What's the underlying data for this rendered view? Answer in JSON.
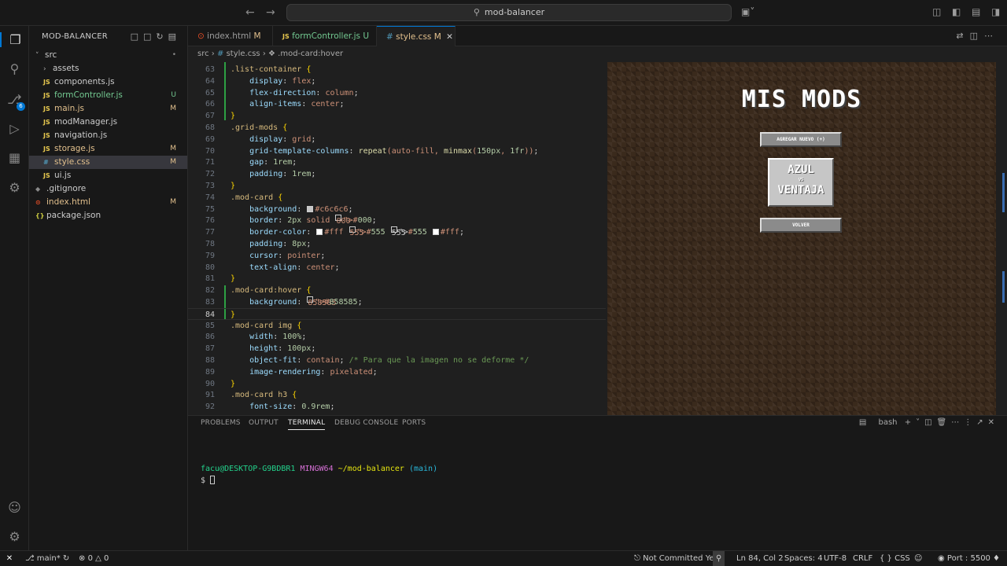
{
  "titlebar": {
    "back_icon": "arrow-left",
    "forward_icon": "arrow-right",
    "search_text": "mod-balancer"
  },
  "activity": {
    "scm_badge": "6"
  },
  "sidebar": {
    "header": "MOD-BALANCER",
    "items": [
      {
        "label": "src",
        "kind": "folder-open",
        "depth": 0,
        "status": "•"
      },
      {
        "label": "assets",
        "kind": "folder",
        "depth": 1,
        "status": ""
      },
      {
        "label": "components.js",
        "kind": "js",
        "depth": 1,
        "status": ""
      },
      {
        "label": "formController.js",
        "kind": "js",
        "depth": 1,
        "status": "U"
      },
      {
        "label": "main.js",
        "kind": "js",
        "depth": 1,
        "status": "M"
      },
      {
        "label": "modManager.js",
        "kind": "js",
        "depth": 1,
        "status": ""
      },
      {
        "label": "navigation.js",
        "kind": "js",
        "depth": 1,
        "status": ""
      },
      {
        "label": "storage.js",
        "kind": "js",
        "depth": 1,
        "status": "M"
      },
      {
        "label": "style.css",
        "kind": "css",
        "depth": 1,
        "status": "M"
      },
      {
        "label": "ui.js",
        "kind": "js",
        "depth": 1,
        "status": ""
      },
      {
        "label": ".gitignore",
        "kind": "git",
        "depth": 0,
        "status": ""
      },
      {
        "label": "index.html",
        "kind": "html",
        "depth": 0,
        "status": "M"
      },
      {
        "label": "package.json",
        "kind": "json",
        "depth": 0,
        "status": ""
      }
    ]
  },
  "tabs": [
    {
      "label": "index.html",
      "status": "M",
      "kind": "html"
    },
    {
      "label": "formController.js",
      "status": "U",
      "kind": "js"
    },
    {
      "label": "style.css",
      "status": "M",
      "kind": "css",
      "active": true
    }
  ],
  "breadcrumb": {
    "part1": "src",
    "part2": "style.css",
    "part3": ".mod-card:hover"
  },
  "code_lines": [
    {
      "n": "63",
      "text": ".list-container {"
    },
    {
      "n": "64",
      "text": "    display: flex;"
    },
    {
      "n": "65",
      "text": "    flex-direction: column;"
    },
    {
      "n": "66",
      "text": "    align-items: center;"
    },
    {
      "n": "67",
      "text": "}"
    },
    {
      "n": "68",
      "text": ".grid-mods {"
    },
    {
      "n": "69",
      "text": "    display: grid;"
    },
    {
      "n": "70",
      "text": "    grid-template-columns: repeat(auto-fill, minmax(150px, 1fr));"
    },
    {
      "n": "71",
      "text": "    gap: 1rem;"
    },
    {
      "n": "72",
      "text": "    padding: 1rem;"
    },
    {
      "n": "73",
      "text": "}"
    },
    {
      "n": "74",
      "text": ".mod-card {"
    },
    {
      "n": "75",
      "text": "    background: #c6c6c6;"
    },
    {
      "n": "76",
      "text": "    border: 2px solid #000;"
    },
    {
      "n": "77",
      "text": "    border-color: #fff #555 #555 #fff;"
    },
    {
      "n": "78",
      "text": "    padding: 8px;"
    },
    {
      "n": "79",
      "text": "    cursor: pointer;"
    },
    {
      "n": "80",
      "text": "    text-align: center;"
    },
    {
      "n": "81",
      "text": "}"
    },
    {
      "n": "82",
      "text": ".mod-card:hover {"
    },
    {
      "n": "83",
      "text": "    background: #858585;"
    },
    {
      "n": "84",
      "text": "}"
    },
    {
      "n": "85",
      "text": ".mod-card img {"
    },
    {
      "n": "86",
      "text": "    width: 100%;"
    },
    {
      "n": "87",
      "text": "    height: 100px;"
    },
    {
      "n": "88",
      "text": "    object-fit: contain; /* Para que la imagen no se deforme */"
    },
    {
      "n": "89",
      "text": "    image-rendering: pixelated;"
    },
    {
      "n": "90",
      "text": "}"
    },
    {
      "n": "91",
      "text": ".mod-card h3 {"
    },
    {
      "n": "92",
      "text": "    font-size: 0.9rem;"
    }
  ],
  "preview": {
    "title": "MIS MODS",
    "add_button": "AGREGAR NUEVO (+)",
    "card_line1": "AZUL",
    "card_line2": "VS",
    "card_line3": "VENTAJA",
    "back_button": "VOLVER"
  },
  "panel": {
    "tabs": [
      "PROBLEMS",
      "OUTPUT",
      "TERMINAL",
      "DEBUG CONSOLE",
      "PORTS"
    ],
    "active_tab": "TERMINAL",
    "shell": "bash",
    "prompt_user": "facu@DESKTOP-G9BDBR1",
    "prompt_env": "MINGW64",
    "prompt_path": "~/mod-balancer",
    "prompt_branch": "(main)",
    "prompt_symbol": "$"
  },
  "statusbar": {
    "branch": "main*",
    "errors": "0",
    "warnings": "0",
    "commit": "Not Committed Yet",
    "position": "Ln 84, Col 2",
    "spaces": "Spaces: 4",
    "encoding": "UTF-8",
    "eol": "CRLF",
    "language": "CSS",
    "port": "Port : 5500"
  },
  "colors": {
    "accent": "#0078d4",
    "modified": "#e2c08d",
    "untracked": "#73c991"
  }
}
